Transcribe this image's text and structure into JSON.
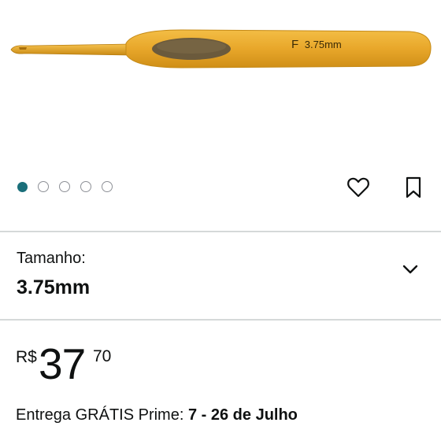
{
  "product": {
    "image_label_letter": "F",
    "image_label_size": "3.75mm"
  },
  "carousel": {
    "total": 5,
    "active_index": 0
  },
  "actions": {
    "favorite_icon": "heart-icon",
    "save_icon": "bookmark-icon"
  },
  "size_selector": {
    "caption": "Tamanho:",
    "value": "3.75mm",
    "icon": "chevron-down-icon"
  },
  "price": {
    "currency": "R$",
    "whole": "37",
    "cents": "70"
  },
  "delivery": {
    "text": "Entrega GRÁTIS Prime: ",
    "dates": "7 - 26 de Julho"
  },
  "colors": {
    "accent": "#1a6f7a",
    "handle": "#e8a72a",
    "grip": "#6b5a3c"
  }
}
